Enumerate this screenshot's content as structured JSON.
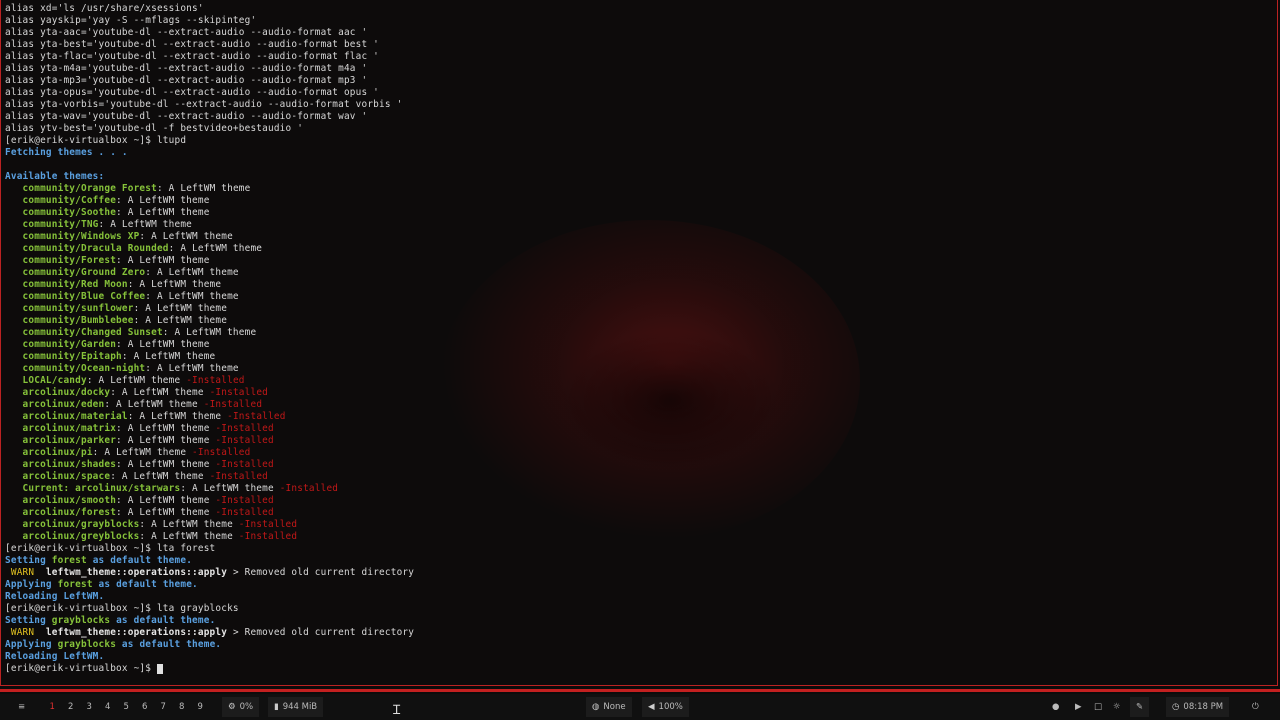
{
  "terminal": {
    "lines": [
      {
        "segs": [
          {
            "t": "alias xd='ls /usr/share/xsessions'"
          }
        ]
      },
      {
        "segs": [
          {
            "t": "alias yayskip='yay -S --mflags --skipinteg'"
          }
        ]
      },
      {
        "segs": [
          {
            "t": "alias yta-aac='youtube-dl --extract-audio --audio-format aac '"
          }
        ]
      },
      {
        "segs": [
          {
            "t": "alias yta-best='youtube-dl --extract-audio --audio-format best '"
          }
        ]
      },
      {
        "segs": [
          {
            "t": "alias yta-flac='youtube-dl --extract-audio --audio-format flac '"
          }
        ]
      },
      {
        "segs": [
          {
            "t": "alias yta-m4a='youtube-dl --extract-audio --audio-format m4a '"
          }
        ]
      },
      {
        "segs": [
          {
            "t": "alias yta-mp3='youtube-dl --extract-audio --audio-format mp3 '"
          }
        ]
      },
      {
        "segs": [
          {
            "t": "alias yta-opus='youtube-dl --extract-audio --audio-format opus '"
          }
        ]
      },
      {
        "segs": [
          {
            "t": "alias yta-vorbis='youtube-dl --extract-audio --audio-format vorbis '"
          }
        ]
      },
      {
        "segs": [
          {
            "t": "alias yta-wav='youtube-dl --extract-audio --audio-format wav '"
          }
        ]
      },
      {
        "segs": [
          {
            "t": "alias ytv-best='youtube-dl -f bestvideo+bestaudio '"
          }
        ]
      },
      {
        "segs": [
          {
            "t": "[erik@erik-virtualbox ~]$ ltupd"
          }
        ]
      },
      {
        "segs": [
          {
            "t": "Fetching themes . . .",
            "c": "blue"
          }
        ]
      },
      {
        "segs": [
          {
            "t": ""
          }
        ]
      },
      {
        "segs": [
          {
            "t": "Available themes:",
            "c": "blue"
          }
        ]
      },
      {
        "segs": [
          {
            "t": "   community/",
            "c": "green"
          },
          {
            "t": "Orange Forest",
            "c": "green"
          },
          {
            "t": ": A LeftWM theme"
          }
        ]
      },
      {
        "segs": [
          {
            "t": "   community/Coffee",
            "c": "green"
          },
          {
            "t": ": A LeftWM theme"
          }
        ]
      },
      {
        "segs": [
          {
            "t": "   community/Soothe",
            "c": "green"
          },
          {
            "t": ": A LeftWM theme"
          }
        ]
      },
      {
        "segs": [
          {
            "t": "   community/TNG",
            "c": "green"
          },
          {
            "t": ": A LeftWM theme"
          }
        ]
      },
      {
        "segs": [
          {
            "t": "   community/Windows XP",
            "c": "green"
          },
          {
            "t": ": A LeftWM theme"
          }
        ]
      },
      {
        "segs": [
          {
            "t": "   community/Dracula Rounded",
            "c": "green"
          },
          {
            "t": ": A LeftWM theme"
          }
        ]
      },
      {
        "segs": [
          {
            "t": "   community/Forest",
            "c": "green"
          },
          {
            "t": ": A LeftWM theme"
          }
        ]
      },
      {
        "segs": [
          {
            "t": "   community/Ground Zero",
            "c": "green"
          },
          {
            "t": ": A LeftWM theme"
          }
        ]
      },
      {
        "segs": [
          {
            "t": "   community/Red Moon",
            "c": "green"
          },
          {
            "t": ": A LeftWM theme"
          }
        ]
      },
      {
        "segs": [
          {
            "t": "   community/Blue Coffee",
            "c": "green"
          },
          {
            "t": ": A LeftWM theme"
          }
        ]
      },
      {
        "segs": [
          {
            "t": "   community/sunflower",
            "c": "green"
          },
          {
            "t": ": A LeftWM theme"
          }
        ]
      },
      {
        "segs": [
          {
            "t": "   community/Bumblebee",
            "c": "green"
          },
          {
            "t": ": A LeftWM theme"
          }
        ]
      },
      {
        "segs": [
          {
            "t": "   community/Changed Sunset",
            "c": "green"
          },
          {
            "t": ": A LeftWM theme"
          }
        ]
      },
      {
        "segs": [
          {
            "t": "   community/Garden",
            "c": "green"
          },
          {
            "t": ": A LeftWM theme"
          }
        ]
      },
      {
        "segs": [
          {
            "t": "   community/Epitaph",
            "c": "green"
          },
          {
            "t": ": A LeftWM theme"
          }
        ]
      },
      {
        "segs": [
          {
            "t": "   community/Ocean-night",
            "c": "green"
          },
          {
            "t": ": A LeftWM theme"
          }
        ]
      },
      {
        "segs": [
          {
            "t": "   LOCAL/candy",
            "c": "green"
          },
          {
            "t": ": A LeftWM theme "
          },
          {
            "t": "-Installed",
            "c": "inst"
          }
        ]
      },
      {
        "segs": [
          {
            "t": "   arcolinux/docky",
            "c": "green"
          },
          {
            "t": ": A LeftWM theme "
          },
          {
            "t": "-Installed",
            "c": "inst"
          }
        ]
      },
      {
        "segs": [
          {
            "t": "   arcolinux/eden",
            "c": "green"
          },
          {
            "t": ": A LeftWM theme "
          },
          {
            "t": "-Installed",
            "c": "inst"
          }
        ]
      },
      {
        "segs": [
          {
            "t": "   arcolinux/material",
            "c": "green"
          },
          {
            "t": ": A LeftWM theme "
          },
          {
            "t": "-Installed",
            "c": "inst"
          }
        ]
      },
      {
        "segs": [
          {
            "t": "   arcolinux/matrix",
            "c": "green"
          },
          {
            "t": ": A LeftWM theme "
          },
          {
            "t": "-Installed",
            "c": "inst"
          }
        ]
      },
      {
        "segs": [
          {
            "t": "   arcolinux/parker",
            "c": "green"
          },
          {
            "t": ": A LeftWM theme "
          },
          {
            "t": "-Installed",
            "c": "inst"
          }
        ]
      },
      {
        "segs": [
          {
            "t": "   arcolinux/pi",
            "c": "green"
          },
          {
            "t": ": A LeftWM theme "
          },
          {
            "t": "-Installed",
            "c": "inst"
          }
        ]
      },
      {
        "segs": [
          {
            "t": "   arcolinux/shades",
            "c": "green"
          },
          {
            "t": ": A LeftWM theme "
          },
          {
            "t": "-Installed",
            "c": "inst"
          }
        ]
      },
      {
        "segs": [
          {
            "t": "   arcolinux/space",
            "c": "green"
          },
          {
            "t": ": A LeftWM theme "
          },
          {
            "t": "-Installed",
            "c": "inst"
          }
        ]
      },
      {
        "segs": [
          {
            "t": "   Current: arcolinux/starwars",
            "c": "green"
          },
          {
            "t": ": A LeftWM theme "
          },
          {
            "t": "-Installed",
            "c": "inst"
          }
        ]
      },
      {
        "segs": [
          {
            "t": "   arcolinux/smooth",
            "c": "green"
          },
          {
            "t": ": A LeftWM theme "
          },
          {
            "t": "-Installed",
            "c": "inst"
          }
        ]
      },
      {
        "segs": [
          {
            "t": "   arcolinux/forest",
            "c": "green"
          },
          {
            "t": ": A LeftWM theme "
          },
          {
            "t": "-Installed",
            "c": "inst"
          }
        ]
      },
      {
        "segs": [
          {
            "t": "   arcolinux/grayblocks",
            "c": "green"
          },
          {
            "t": ": A LeftWM theme "
          },
          {
            "t": "-Installed",
            "c": "inst"
          }
        ]
      },
      {
        "segs": [
          {
            "t": "   arcolinux/greyblocks",
            "c": "green"
          },
          {
            "t": ": A LeftWM theme "
          },
          {
            "t": "-Installed",
            "c": "inst"
          }
        ]
      },
      {
        "segs": [
          {
            "t": "[erik@erik-virtualbox ~]$ lta forest"
          }
        ]
      },
      {
        "segs": [
          {
            "t": "Setting ",
            "c": "blue"
          },
          {
            "t": "forest",
            "c": "green"
          },
          {
            "t": " as default theme.",
            "c": "blue"
          }
        ]
      },
      {
        "segs": [
          {
            "t": " WARN ",
            "c": "warn"
          },
          {
            "t": " leftwm_theme::operations::apply",
            "c": "bold"
          },
          {
            "t": " > Removed old current directory"
          }
        ]
      },
      {
        "segs": [
          {
            "t": "Applying ",
            "c": "blue"
          },
          {
            "t": "forest",
            "c": "green"
          },
          {
            "t": " as default theme.",
            "c": "blue"
          }
        ]
      },
      {
        "segs": [
          {
            "t": "Reloading LeftWM.",
            "c": "blue"
          }
        ]
      },
      {
        "segs": [
          {
            "t": "[erik@erik-virtualbox ~]$ lta grayblocks"
          }
        ]
      },
      {
        "segs": [
          {
            "t": "Setting ",
            "c": "blue"
          },
          {
            "t": "grayblocks",
            "c": "green"
          },
          {
            "t": " as default theme.",
            "c": "blue"
          }
        ]
      },
      {
        "segs": [
          {
            "t": " WARN ",
            "c": "warn"
          },
          {
            "t": " leftwm_theme::operations::apply",
            "c": "bold"
          },
          {
            "t": " > Removed old current directory"
          }
        ]
      },
      {
        "segs": [
          {
            "t": "Applying ",
            "c": "blue"
          },
          {
            "t": "grayblocks",
            "c": "green"
          },
          {
            "t": " as default theme.",
            "c": "blue"
          }
        ]
      },
      {
        "segs": [
          {
            "t": "Reloading LeftWM.",
            "c": "blue"
          }
        ]
      },
      {
        "segs": [
          {
            "t": "[erik@erik-virtualbox ~]$ "
          }
        ],
        "cursor": true
      }
    ]
  },
  "statusbar": {
    "menu_icon": "≡",
    "workspaces": [
      "1",
      "2",
      "3",
      "4",
      "5",
      "6",
      "7",
      "8",
      "9"
    ],
    "active_workspace": "1",
    "cpu": {
      "icon": "cpu-icon",
      "value": "0%"
    },
    "mem": {
      "icon": "memory-icon",
      "value": "944 MiB"
    },
    "network": {
      "icon": "network-icon",
      "value": "None"
    },
    "volume": {
      "icon": "volume-icon",
      "value": "100%"
    },
    "clock": {
      "icon": "clock-icon",
      "value": "08:18 PM"
    },
    "tray_icons": [
      "record-icon",
      "play-icon",
      "window-icon",
      "settings-icon",
      "pen-icon"
    ],
    "power_icon": "power-icon"
  },
  "colors": {
    "accent": "#c42020",
    "blue": "#5aa0e0",
    "green": "#86c23a",
    "installed": "#c01818"
  }
}
